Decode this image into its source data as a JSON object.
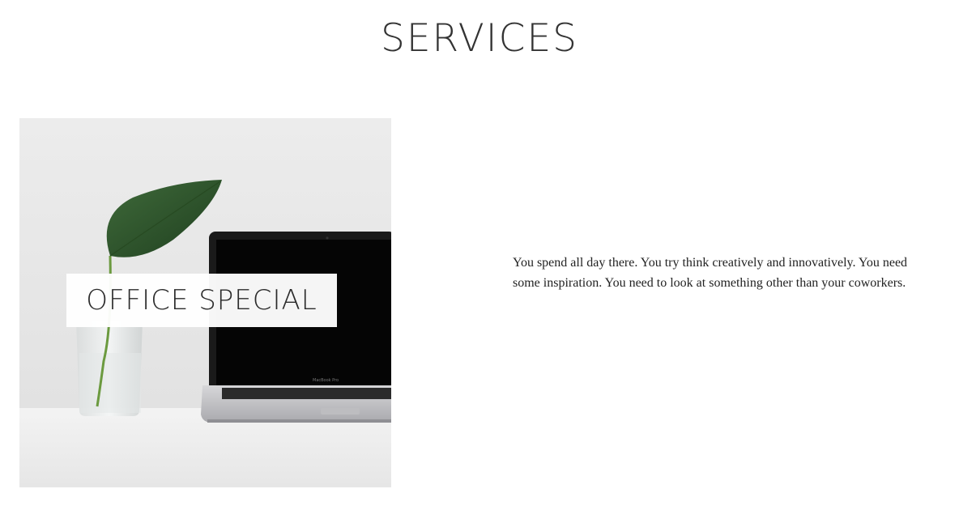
{
  "section": {
    "title": "SERVICES"
  },
  "service_card": {
    "overlay_label": "OFFICE SPECIAL",
    "image_icon": "plant-and-laptop-photo",
    "laptop_brand_text": "MacBook Pro",
    "description": "You spend all day there. You try think creatively and innovatively. You need some inspiration. You need to look at something other than your coworkers."
  },
  "colors": {
    "background": "#ffffff",
    "title_text": "#333333",
    "body_text": "#222222",
    "photo_background": "#e9e9e9"
  }
}
